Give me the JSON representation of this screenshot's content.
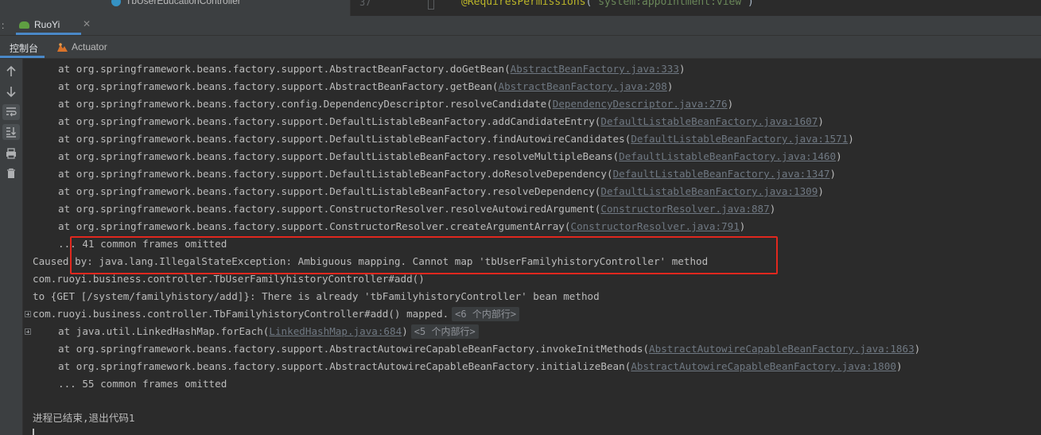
{
  "editor_strip": {
    "tree_item": "TbUserEducationController",
    "line_number": "37",
    "code_annotation": "@RequiresPermissions",
    "code_open": "(",
    "code_string": "\"system:appointment:view\"",
    "code_close": ")"
  },
  "run_tabs": {
    "prefix": ":",
    "active_tab": "RuoYi",
    "close_glyph": "✕"
  },
  "sub_tabs": {
    "console": "控制台",
    "actuator": "Actuator"
  },
  "toolbar": {
    "icons": [
      "arrow-up-icon",
      "arrow-down-icon",
      "soft-wrap-icon",
      "scroll-to-end-icon",
      "print-icon",
      "trash-icon"
    ]
  },
  "console": {
    "stack_a": [
      {
        "text": "at org.springframework.beans.factory.support.AbstractBeanFactory.doGetBean(",
        "link": "AbstractBeanFactory.java:333",
        "tail": ")"
      },
      {
        "text": "at org.springframework.beans.factory.support.AbstractBeanFactory.getBean(",
        "link": "AbstractBeanFactory.java:208",
        "tail": ")"
      },
      {
        "text": "at org.springframework.beans.factory.config.DependencyDescriptor.resolveCandidate(",
        "link": "DependencyDescriptor.java:276",
        "tail": ")"
      },
      {
        "text": "at org.springframework.beans.factory.support.DefaultListableBeanFactory.addCandidateEntry(",
        "link": "DefaultListableBeanFactory.java:1607",
        "tail": ")"
      },
      {
        "text": "at org.springframework.beans.factory.support.DefaultListableBeanFactory.findAutowireCandidates(",
        "link": "DefaultListableBeanFactory.java:1571",
        "tail": ")"
      },
      {
        "text": "at org.springframework.beans.factory.support.DefaultListableBeanFactory.resolveMultipleBeans(",
        "link": "DefaultListableBeanFactory.java:1460",
        "tail": ")"
      },
      {
        "text": "at org.springframework.beans.factory.support.DefaultListableBeanFactory.doResolveDependency(",
        "link": "DefaultListableBeanFactory.java:1347",
        "tail": ")"
      },
      {
        "text": "at org.springframework.beans.factory.support.DefaultListableBeanFactory.resolveDependency(",
        "link": "DefaultListableBeanFactory.java:1309",
        "tail": ")"
      },
      {
        "text": "at org.springframework.beans.factory.support.ConstructorResolver.resolveAutowiredArgument(",
        "link": "ConstructorResolver.java:887",
        "tail": ")"
      },
      {
        "text": "at org.springframework.beans.factory.support.ConstructorResolver.createArgumentArray(",
        "link": "ConstructorResolver.java:791",
        "tail": ")"
      }
    ],
    "omitted_41": "... 41 common frames omitted",
    "caused_by": "Caused by: java.lang.IllegalStateException: Ambiguous mapping. Cannot map 'tbUserFamilyhistoryController' method",
    "add_method": "com.ruoyi.business.controller.TbUserFamilyhistoryController#add()",
    "to_get": "to {GET [/system/familyhistory/add]}: There is already 'tbFamilyhistoryController' bean method",
    "mapped_line": "com.ruoyi.business.controller.TbFamilyhistoryController#add() mapped.",
    "mapped_fold": "<6 个内部行>",
    "foreach_line": "at java.util.LinkedHashMap.forEach(",
    "foreach_link": "LinkedHashMap.java:684",
    "foreach_tail": ")",
    "foreach_fold": "<5 个内部行>",
    "stack_b": [
      {
        "text": "at org.springframework.beans.factory.support.AbstractAutowireCapableBeanFactory.invokeInitMethods(",
        "link": "AbstractAutowireCapableBeanFactory.java:1863",
        "tail": ")"
      },
      {
        "text": "at org.springframework.beans.factory.support.AbstractAutowireCapableBeanFactory.initializeBean(",
        "link": "AbstractAutowireCapableBeanFactory.java:1800",
        "tail": ")"
      }
    ],
    "omitted_55": "... 55 common frames omitted",
    "exit": "进程已结束,退出代码1"
  },
  "colors": {
    "background": "#2b2b2b",
    "panel": "#3c3f41",
    "text": "#bbbbbb",
    "link": "#6f7882",
    "accent": "#4a88c7",
    "highlight_box": "#e0281e"
  }
}
